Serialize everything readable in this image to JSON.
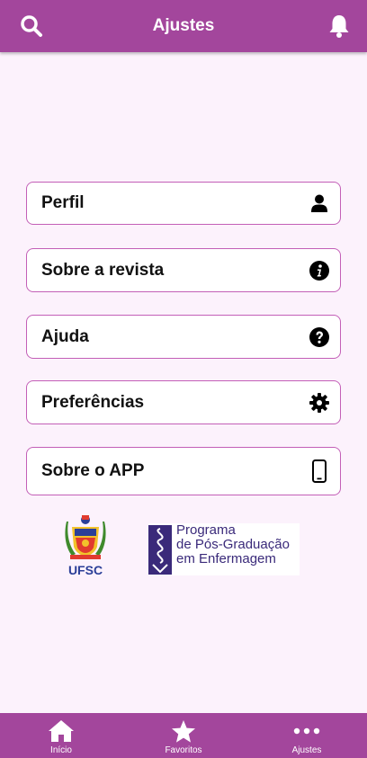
{
  "header": {
    "title": "Ajustes",
    "search_icon": "search-icon",
    "bell_icon": "bell-icon",
    "color": "#a3469c"
  },
  "menu": {
    "items": [
      {
        "label": "Perfil",
        "icon": "user-icon"
      },
      {
        "label": "Sobre a revista",
        "icon": "info-circle-icon"
      },
      {
        "label": "Ajuda",
        "icon": "question-circle-icon"
      },
      {
        "label": "Preferências",
        "icon": "gear-icon"
      },
      {
        "label": "Sobre o APP",
        "icon": "mobile-phone-icon"
      }
    ],
    "border_color": "#c35fb7"
  },
  "logos": {
    "ufsc": "UFSC",
    "ppg_lines": [
      "Programa",
      "de Pós-Graduação",
      "em Enfermagem"
    ]
  },
  "bottom_nav": {
    "tabs": [
      {
        "label": "Início",
        "icon": "home-icon"
      },
      {
        "label": "Favoritos",
        "icon": "star-icon"
      },
      {
        "label": "Ajustes",
        "icon": "more-dots-icon"
      }
    ],
    "color": "#a3469c"
  }
}
